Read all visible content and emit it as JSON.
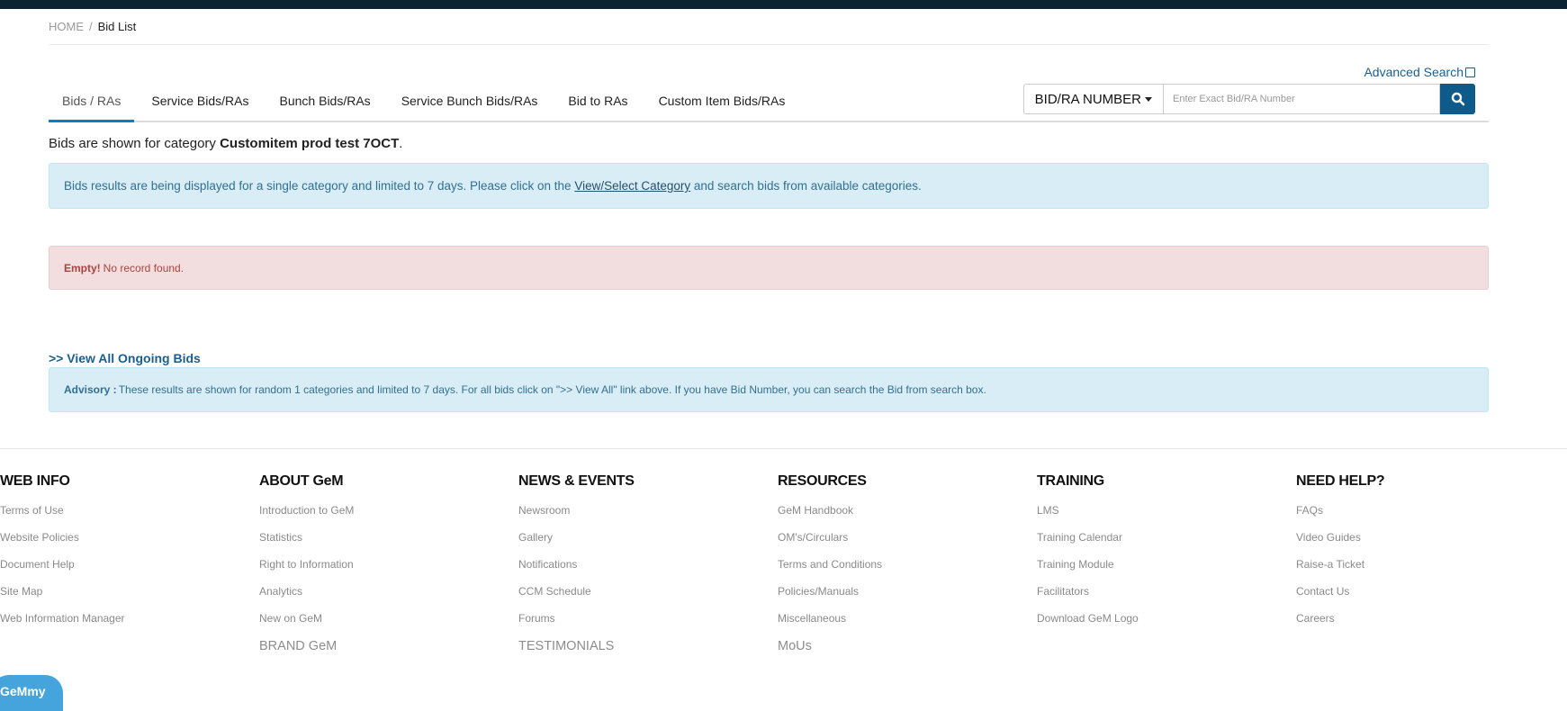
{
  "breadcrumb": {
    "home": "HOME",
    "separator": "/",
    "current": "Bid List"
  },
  "tabs": [
    {
      "label": "Bids / RAs",
      "active": true
    },
    {
      "label": "Service Bids/RAs",
      "active": false
    },
    {
      "label": "Bunch Bids/RAs",
      "active": false
    },
    {
      "label": "Service Bunch Bids/RAs",
      "active": false
    },
    {
      "label": "Bid to RAs",
      "active": false
    },
    {
      "label": "Custom Item Bids/RAs",
      "active": false
    }
  ],
  "search": {
    "advanced_label": "Advanced Search",
    "type_label": "BID/RA NUMBER",
    "placeholder": "Enter Exact Bid/RA Number",
    "value": ""
  },
  "category": {
    "prefix": "Bids are shown for category ",
    "name": "Customitem prod test 7OCT",
    "suffix": "."
  },
  "info_alert": {
    "text_before": "Bids results are being displayed for a single category and limited to 7 days. Please click on the ",
    "link": "View/Select Category",
    "text_after": " and search bids from available categories."
  },
  "empty_alert": {
    "strong": "Empty!",
    "text": "No record found."
  },
  "view_all_link": ">> View All Ongoing Bids",
  "advisory": {
    "strong": "Advisory :",
    "text": "These results are shown for random 1 categories and limited to 7 days. For all bids click on \">> View All\" link above. If you have Bid Number, you can search the Bid from search box."
  },
  "footer": {
    "columns": [
      {
        "title": "WEB INFO",
        "links": [
          "Terms of Use",
          "Website Policies",
          "Document Help",
          "Site Map",
          "Web Information Manager"
        ],
        "extra": ""
      },
      {
        "title": "ABOUT GeM",
        "links": [
          "Introduction to GeM",
          "Statistics",
          "Right to Information",
          "Analytics",
          "New on GeM"
        ],
        "extra": "BRAND GeM"
      },
      {
        "title": "NEWS & EVENTS",
        "links": [
          "Newsroom",
          "Gallery",
          "Notifications",
          "CCM Schedule",
          "Forums"
        ],
        "extra": "TESTIMONIALS"
      },
      {
        "title": "RESOURCES",
        "links": [
          "GeM Handbook",
          "OM's/Circulars",
          "Terms and Conditions",
          "Policies/Manuals",
          "Miscellaneous"
        ],
        "extra": "MoUs"
      },
      {
        "title": "TRAINING",
        "links": [
          "LMS",
          "Training Calendar",
          "Training Module",
          "Facilitators",
          "Download GeM Logo"
        ],
        "extra": ""
      },
      {
        "title": "NEED HELP?",
        "links": [
          "FAQs",
          "Video Guides",
          "Raise-a Ticket",
          "Contact Us",
          "Careers"
        ],
        "extra": ""
      }
    ]
  },
  "chat_widget": {
    "label": "GeMmy"
  },
  "colors": {
    "topbar": "#0b2233",
    "accent": "#0a7cc0",
    "link": "#1b5f8e",
    "search_button": "#0e5a8a"
  }
}
